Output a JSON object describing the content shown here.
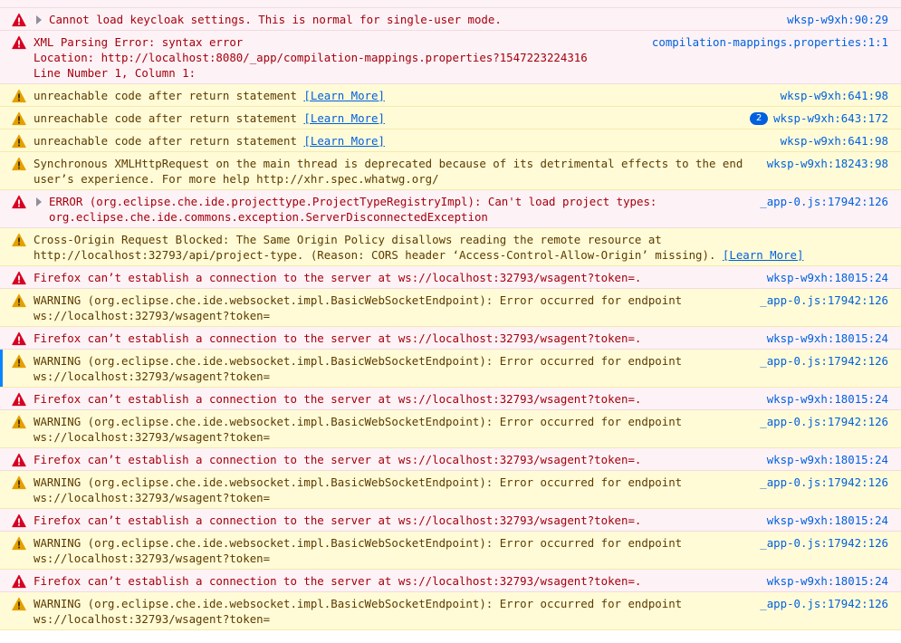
{
  "console": {
    "colors": {
      "error_bg": "#fdf2f5",
      "warn_bg": "#fffbd6",
      "error_text": "#a4000f",
      "warn_text": "#5c3b00",
      "link": "#0060df"
    },
    "rows": [
      {
        "level": "error",
        "twisty": true,
        "text": "Cannot load keycloak settings. This is normal for single-user mode.",
        "learn_more": "",
        "source": "wksp-w9xh:90:29",
        "count": ""
      },
      {
        "level": "error",
        "twisty": false,
        "text": "XML Parsing Error: syntax error\nLocation: http://localhost:8080/_app/compilation-mappings.properties?1547223224316\nLine Number 1, Column 1:",
        "learn_more": "",
        "source": "compilation-mappings.properties:1:1",
        "count": ""
      },
      {
        "level": "warn",
        "twisty": false,
        "text": "unreachable code after return statement ",
        "learn_more": "[Learn More]",
        "source": "wksp-w9xh:641:98",
        "count": ""
      },
      {
        "level": "warn",
        "twisty": false,
        "text": "unreachable code after return statement ",
        "learn_more": "[Learn More]",
        "source": "wksp-w9xh:643:172",
        "count": "2"
      },
      {
        "level": "warn",
        "twisty": false,
        "text": "unreachable code after return statement ",
        "learn_more": "[Learn More]",
        "source": "wksp-w9xh:641:98",
        "count": ""
      },
      {
        "level": "warn",
        "twisty": false,
        "text": "Synchronous XMLHttpRequest on the main thread is deprecated because of its detrimental effects to the end user’s experience. For more help http://xhr.spec.whatwg.org/",
        "learn_more": "",
        "source": "wksp-w9xh:18243:98",
        "count": ""
      },
      {
        "level": "error",
        "twisty": true,
        "text": "ERROR (org.eclipse.che.ide.projecttype.ProjectTypeRegistryImpl): Can't load project types: org.eclipse.che.ide.commons.exception.ServerDisconnectedException",
        "learn_more": "",
        "source": "_app-0.js:17942:126",
        "count": ""
      },
      {
        "level": "warn",
        "twisty": false,
        "text": "Cross-Origin Request Blocked: The Same Origin Policy disallows reading the remote resource at http://localhost:32793/api/project-type. (Reason: CORS header ‘Access-Control-Allow-Origin’ missing). ",
        "learn_more": "[Learn More]",
        "source": "",
        "count": ""
      },
      {
        "level": "error",
        "twisty": false,
        "text": "Firefox can’t establish a connection to the server at ws://localhost:32793/wsagent?token=.",
        "learn_more": "",
        "source": "wksp-w9xh:18015:24",
        "count": ""
      },
      {
        "level": "warn",
        "twisty": false,
        "text": "WARNING (org.eclipse.che.ide.websocket.impl.BasicWebSocketEndpoint): Error occurred for endpoint ws://localhost:32793/wsagent?token=",
        "learn_more": "",
        "source": "_app-0.js:17942:126",
        "count": ""
      },
      {
        "level": "error",
        "twisty": false,
        "text": "Firefox can’t establish a connection to the server at ws://localhost:32793/wsagent?token=.",
        "learn_more": "",
        "source": "wksp-w9xh:18015:24",
        "count": ""
      },
      {
        "level": "warn",
        "twisty": false,
        "selected": true,
        "text": "WARNING (org.eclipse.che.ide.websocket.impl.BasicWebSocketEndpoint): Error occurred for endpoint ws://localhost:32793/wsagent?token=",
        "learn_more": "",
        "source": "_app-0.js:17942:126",
        "count": ""
      },
      {
        "level": "error",
        "twisty": false,
        "text": "Firefox can’t establish a connection to the server at ws://localhost:32793/wsagent?token=.",
        "learn_more": "",
        "source": "wksp-w9xh:18015:24",
        "count": ""
      },
      {
        "level": "warn",
        "twisty": false,
        "text": "WARNING (org.eclipse.che.ide.websocket.impl.BasicWebSocketEndpoint): Error occurred for endpoint ws://localhost:32793/wsagent?token=",
        "learn_more": "",
        "source": "_app-0.js:17942:126",
        "count": ""
      },
      {
        "level": "error",
        "twisty": false,
        "text": "Firefox can’t establish a connection to the server at ws://localhost:32793/wsagent?token=.",
        "learn_more": "",
        "source": "wksp-w9xh:18015:24",
        "count": ""
      },
      {
        "level": "warn",
        "twisty": false,
        "text": "WARNING (org.eclipse.che.ide.websocket.impl.BasicWebSocketEndpoint): Error occurred for endpoint ws://localhost:32793/wsagent?token=",
        "learn_more": "",
        "source": "_app-0.js:17942:126",
        "count": ""
      },
      {
        "level": "error",
        "twisty": false,
        "text": "Firefox can’t establish a connection to the server at ws://localhost:32793/wsagent?token=.",
        "learn_more": "",
        "source": "wksp-w9xh:18015:24",
        "count": ""
      },
      {
        "level": "warn",
        "twisty": false,
        "text": "WARNING (org.eclipse.che.ide.websocket.impl.BasicWebSocketEndpoint): Error occurred for endpoint ws://localhost:32793/wsagent?token=",
        "learn_more": "",
        "source": "_app-0.js:17942:126",
        "count": ""
      },
      {
        "level": "error",
        "twisty": false,
        "text": "Firefox can’t establish a connection to the server at ws://localhost:32793/wsagent?token=.",
        "learn_more": "",
        "source": "wksp-w9xh:18015:24",
        "count": ""
      },
      {
        "level": "warn",
        "twisty": false,
        "text": "WARNING (org.eclipse.che.ide.websocket.impl.BasicWebSocketEndpoint): Error occurred for endpoint ws://localhost:32793/wsagent?token=",
        "learn_more": "",
        "source": "_app-0.js:17942:126",
        "count": ""
      }
    ]
  }
}
